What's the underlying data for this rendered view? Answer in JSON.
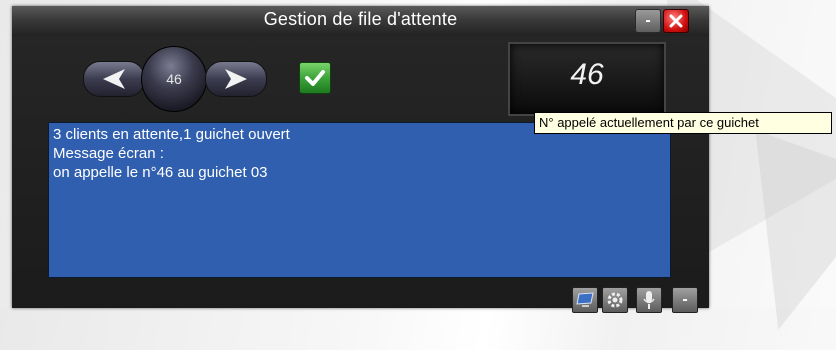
{
  "window": {
    "title": "Gestion de file d'attente",
    "minimize_label": "-",
    "close_icon": "close-icon"
  },
  "controls": {
    "previous_icon": "arrow-left-icon",
    "next_icon": "arrow-right-icon",
    "current_ticket": "46",
    "validate_icon": "checkmark-icon"
  },
  "display": {
    "called_number": "46"
  },
  "tooltip": {
    "text": "N° appelé actuellement par ce guichet"
  },
  "messages": {
    "lines": [
      "3 clients en attente,1 guichet ouvert",
      "Message écran :",
      "on appelle le n°46 au guichet 03"
    ]
  },
  "toolbar": {
    "items": [
      "monitor-icon",
      "settings-icon",
      "microphone-icon"
    ],
    "collapse_label": "-"
  },
  "colors": {
    "message_panel": "#2f5fae",
    "validate": "#3ca43a",
    "close": "#d01010",
    "tooltip_bg": "#ffffe1"
  }
}
